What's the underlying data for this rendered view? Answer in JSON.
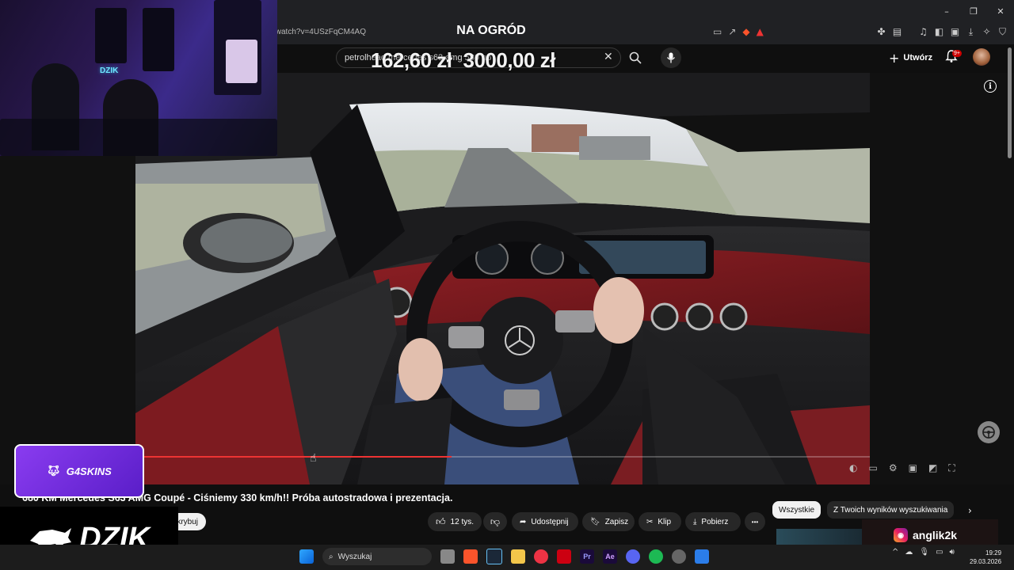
{
  "browser": {
    "url": "/watch?v=4USzFqCM4AQ",
    "overlay_title": "NA OGRÓD",
    "window_controls": [
      "–",
      "❐",
      "✕"
    ]
  },
  "youtube": {
    "search_value": "petrolhead mercedes s63 amg 580 hp",
    "create_label": "Utwórz",
    "notification_badge": "9+",
    "price_overlay": {
      "left": "162,60 zł",
      "right": "3000,00 zł"
    }
  },
  "webcam": {
    "neon_text": "DZIK"
  },
  "video": {
    "title": "680 KM Mercedes S63 AMG Coupé - Ciśniemy 330 km/h!! Próba autostradowa i prezentacja.",
    "subscribe_label": "Subskrybuj",
    "likes": "12 tys.",
    "share_label": "Udostępnij",
    "save_label": "Zapisz",
    "clip_label": "Klip",
    "download_label": "Pobierz",
    "progress_fraction": 0.43,
    "more_label": "•••"
  },
  "chips": [
    "Wszystkie",
    "Z Twoich wyników wyszukiwania"
  ],
  "overlays": {
    "g4skins": "G4SKINS",
    "dzik": "DZIK",
    "instagram_handle": "anglik2k"
  },
  "taskbar": {
    "search_placeholder": "Wyszukaj",
    "time": "19:29",
    "date": "29.03.2026"
  },
  "colors": {
    "accent_red": "#cc0000",
    "g4skins_purple": "#7a34e8",
    "yt_dark": "#0f0f0f"
  }
}
